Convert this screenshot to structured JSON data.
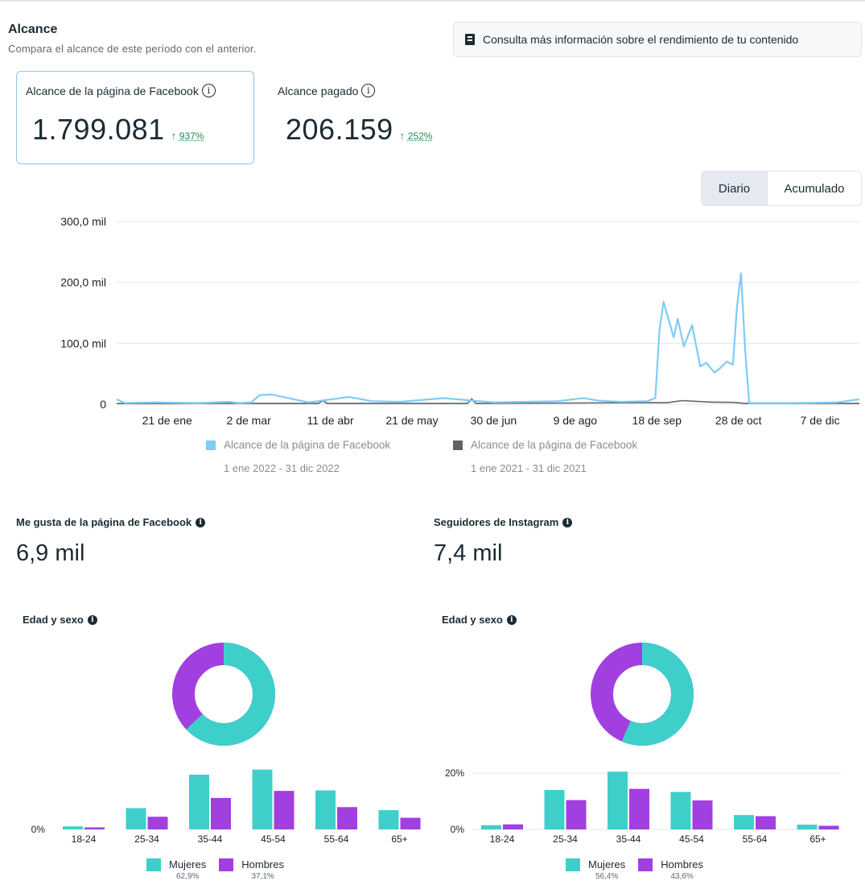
{
  "header": {
    "title": "Alcance",
    "subtitle": "Compara el alcance de este período con el anterior.",
    "info_button": "Consulta más información sobre el rendimiento de tu contenido"
  },
  "metrics": {
    "facebook_reach": {
      "label": "Alcance de la página de Facebook",
      "value": "1.799.081",
      "delta": "937%"
    },
    "paid_reach": {
      "label": "Alcance pagado",
      "value": "206.159",
      "delta": "252%"
    }
  },
  "toggle": {
    "daily": "Diario",
    "cumulative": "Acumulado"
  },
  "colors": {
    "current": "#7dcdf4",
    "previous": "#5f6368",
    "women": "#3ecfcb",
    "men": "#a23fe0",
    "positive": "#2b8a57"
  },
  "legend": {
    "current": {
      "label": "Alcance de la página de Facebook",
      "range": "1 ene 2022 - 31 dic 2022"
    },
    "previous": {
      "label": "Alcance de la página de Facebook",
      "range": "1 ene 2021 - 31 dic 2021"
    }
  },
  "chart_data": [
    {
      "type": "line",
      "y_ticks": [
        "300,0 mil",
        "200,0 mil",
        "100,0 mil",
        "0"
      ],
      "ylim": [
        0,
        300000
      ],
      "x_ticks": [
        "21 de ene",
        "2 de mar",
        "11 de abr",
        "21 de may",
        "30 de jun",
        "9 de ago",
        "18 de sep",
        "28 de oct",
        "7 de dic"
      ],
      "series": [
        {
          "name": "Alcance de la página de Facebook",
          "x": [
            "2022-01-01",
            "2022-01-05",
            "2022-01-20",
            "2022-02-10",
            "2022-02-25",
            "2022-03-02",
            "2022-03-08",
            "2022-03-12",
            "2022-03-18",
            "2022-04-05",
            "2022-04-25",
            "2022-05-06",
            "2022-05-20",
            "2022-06-10",
            "2022-07-05",
            "2022-07-20",
            "2022-08-05",
            "2022-08-18",
            "2022-08-25",
            "2022-09-05",
            "2022-09-18",
            "2022-09-22",
            "2022-09-24",
            "2022-09-26",
            "2022-09-28",
            "2022-10-01",
            "2022-10-03",
            "2022-10-06",
            "2022-10-10",
            "2022-10-14",
            "2022-10-17",
            "2022-10-21",
            "2022-10-24",
            "2022-10-27",
            "2022-10-30",
            "2022-11-01",
            "2022-11-03",
            "2022-11-05",
            "2022-11-07",
            "2022-11-30",
            "2022-12-20",
            "2022-12-31"
          ],
          "values": [
            8000,
            2000,
            3000,
            2000,
            4000,
            2000,
            3000,
            15000,
            16000,
            3000,
            12000,
            5000,
            4000,
            10000,
            3000,
            4000,
            5000,
            10000,
            6000,
            4000,
            5000,
            10000,
            120000,
            168000,
            145000,
            110000,
            140000,
            95000,
            130000,
            62000,
            68000,
            52000,
            60000,
            70000,
            65000,
            160000,
            215000,
            90000,
            2000,
            2000,
            3000,
            8000
          ]
        },
        {
          "name": "Alcance de la página de Facebook",
          "x": [
            "2022-01-01",
            "2022-02-20",
            "2022-04-10",
            "2022-04-12",
            "2022-04-14",
            "2022-06-10",
            "2022-06-22",
            "2022-06-24",
            "2022-06-26",
            "2022-08-10",
            "2022-09-15",
            "2022-09-28",
            "2022-10-05",
            "2022-10-20",
            "2022-10-30",
            "2022-11-05",
            "2022-12-31"
          ],
          "values": [
            1000,
            1500,
            1500,
            6000,
            1500,
            1500,
            1500,
            9000,
            1500,
            2000,
            2500,
            2500,
            6000,
            3500,
            3000,
            1500,
            1500
          ]
        }
      ]
    },
    {
      "type": "bar",
      "title": "Edad y sexo",
      "categories": [
        "18-24",
        "25-34",
        "35-44",
        "45-54",
        "55-64",
        "65+"
      ],
      "y_ticks": [
        "0%"
      ],
      "series": [
        {
          "name": "Mujeres",
          "values": [
            0.6,
            4.2,
            10.8,
            11.8,
            7.7,
            3.8
          ]
        },
        {
          "name": "Hombres",
          "values": [
            0.4,
            2.5,
            6.2,
            7.6,
            4.4,
            2.3
          ]
        }
      ],
      "donut": {
        "Mujeres": 62.9,
        "Hombres": 37.1
      },
      "legend": {
        "women": "Mujeres",
        "men": "Hombres",
        "women_pct": "62,9%",
        "men_pct": "37,1%"
      }
    },
    {
      "type": "bar",
      "title": "Edad y sexo",
      "categories": [
        "18-24",
        "25-34",
        "35-44",
        "45-54",
        "55-64",
        "65+"
      ],
      "y_ticks": [
        "20%",
        "0%"
      ],
      "ylim": [
        0,
        20
      ],
      "series": [
        {
          "name": "Mujeres",
          "values": [
            1.5,
            14.0,
            20.5,
            13.3,
            5.1,
            1.7
          ]
        },
        {
          "name": "Hombres",
          "values": [
            1.8,
            10.4,
            14.4,
            10.3,
            4.7,
            1.3
          ]
        }
      ],
      "donut": {
        "Mujeres": 56.4,
        "Hombres": 43.6
      },
      "legend": {
        "women": "Mujeres",
        "men": "Hombres",
        "women_pct": "56,4%",
        "men_pct": "43,6%"
      }
    }
  ],
  "stats": {
    "fb_likes": {
      "label": "Me gusta de la página de Facebook",
      "value": "6,9 mil"
    },
    "ig_followers": {
      "label": "Seguidores de Instagram",
      "value": "7,4 mil"
    }
  }
}
